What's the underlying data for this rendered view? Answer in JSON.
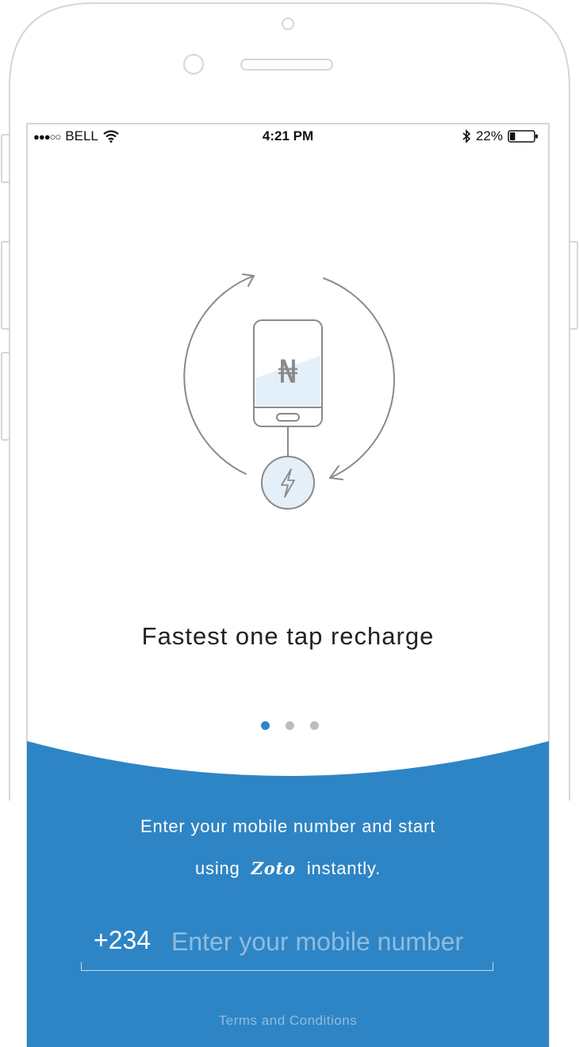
{
  "status_bar": {
    "signal": "●●●○○",
    "carrier": "BELL",
    "time": "4:21 PM",
    "battery_percent": "22%",
    "battery_level": 0.22
  },
  "carousel": {
    "headline": "Fastest one tap recharge",
    "currency_symbol": "₦",
    "total_pages": 3,
    "active_page": 1
  },
  "signup": {
    "line1": "Enter your mobile number and start",
    "line2_prefix": "using",
    "brand": "Zoto",
    "line2_suffix": "instantly.",
    "country_code": "+234",
    "phone_placeholder": "Enter your mobile number",
    "terms_link": "Terms and Conditions"
  },
  "colors": {
    "accent": "#2e85c5",
    "illustration_stroke": "#8a8a8a",
    "illustration_fill": "#e3f0fa"
  }
}
